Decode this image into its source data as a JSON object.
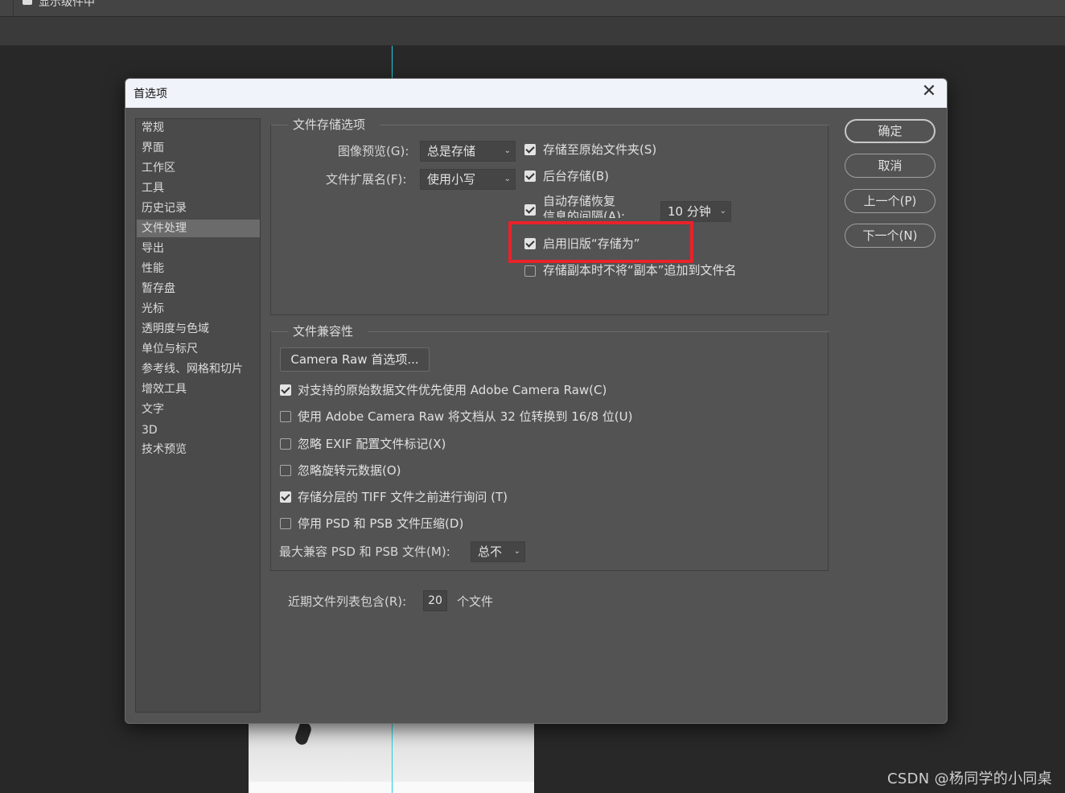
{
  "background": {
    "topbar_label": "显示级件中",
    "watermark": "CSDN @杨同学的小同桌"
  },
  "dialog": {
    "title": "首选项",
    "close_glyph": "✕",
    "sidebar": [
      {
        "label": "常规"
      },
      {
        "label": "界面"
      },
      {
        "label": "工作区"
      },
      {
        "label": "工具"
      },
      {
        "label": "历史记录"
      },
      {
        "label": "文件处理",
        "active": true
      },
      {
        "label": "导出"
      },
      {
        "label": "性能"
      },
      {
        "label": "暂存盘"
      },
      {
        "label": "光标"
      },
      {
        "label": "透明度与色域"
      },
      {
        "label": "单位与标尺"
      },
      {
        "label": "参考线、网格和切片"
      },
      {
        "label": "增效工具"
      },
      {
        "label": "文字"
      },
      {
        "label": "3D"
      },
      {
        "label": "技术预览"
      }
    ],
    "file_save": {
      "title": "文件存储选项",
      "image_preview": {
        "label": "图像预览(G):",
        "value": "总是存储"
      },
      "file_extension": {
        "label": "文件扩展名(F):",
        "value": "使用小写"
      },
      "save_to_original": {
        "label": "存储至原始文件夹(S)",
        "checked": true
      },
      "background_save": {
        "label": "后台存储(B)",
        "checked": true
      },
      "autosave": {
        "label_line1": "自动存储恢复",
        "label_line2": "信息的间隔(A):",
        "checked": true,
        "interval": "10 分钟"
      },
      "legacy_save_as": {
        "label": "启用旧版“存储为”",
        "checked": true
      },
      "no_copy_suffix": {
        "label": "存储副本时不将“副本”追加到文件名",
        "checked": false
      }
    },
    "compat": {
      "title": "文件兼容性",
      "camera_raw_button": "Camera Raw 首选项...",
      "options": [
        {
          "label": "对支持的原始数据文件优先使用 Adobe Camera Raw(C)",
          "checked": true
        },
        {
          "label": "使用 Adobe Camera Raw 将文档从 32 位转换到 16/8 位(U)",
          "checked": false
        },
        {
          "label": "忽略 EXIF 配置文件标记(X)",
          "checked": false
        },
        {
          "label": "忽略旋转元数据(O)",
          "checked": false
        },
        {
          "label": "存储分层的 TIFF 文件之前进行询问  (T)",
          "checked": true
        },
        {
          "label": "停用 PSD 和 PSB 文件压缩(D)",
          "checked": false
        }
      ],
      "max_compat": {
        "label": "最大兼容 PSD 和 PSB 文件(M):",
        "value": "总不"
      }
    },
    "recent": {
      "label": "近期文件列表包含(R):",
      "value": "20",
      "suffix": "个文件"
    },
    "buttons": {
      "ok": "确定",
      "cancel": "取消",
      "prev": "上一个(P)",
      "next": "下一个(N)"
    }
  }
}
